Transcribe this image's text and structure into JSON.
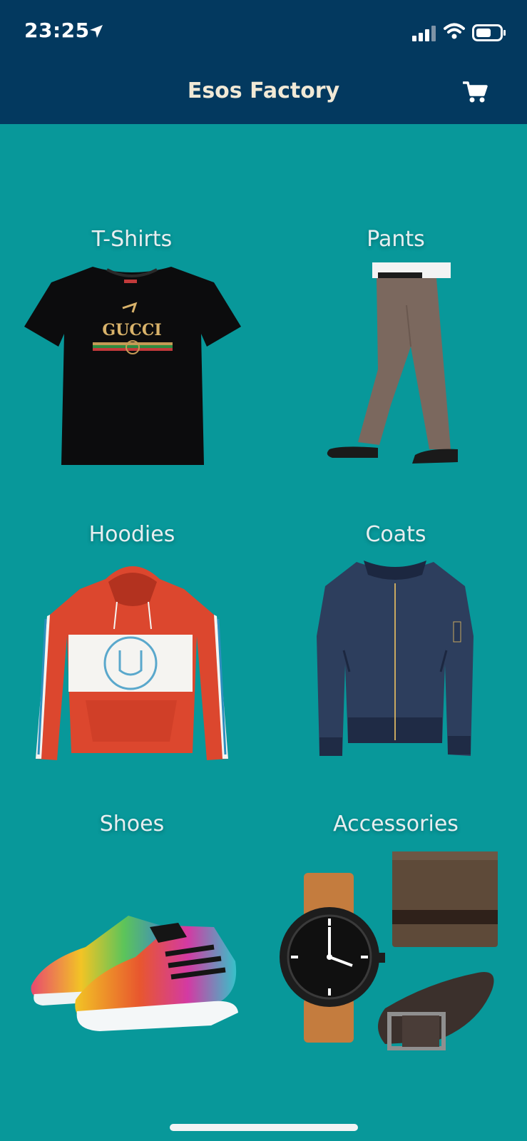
{
  "status_bar": {
    "time": "23:25"
  },
  "header": {
    "title": "Esos Factory",
    "cart_icon": "cart-icon"
  },
  "categories": [
    {
      "label": "T-Shirts",
      "image": "t-shirt"
    },
    {
      "label": "Pants",
      "image": "pants"
    },
    {
      "label": "Hoodies",
      "image": "hoodie"
    },
    {
      "label": "Coats",
      "image": "coat"
    },
    {
      "label": "Shoes",
      "image": "sneakers"
    },
    {
      "label": "Accessories",
      "image": "watch-wallet-belt"
    }
  ],
  "tshirt_logo": "GUCCI",
  "colors": {
    "header_bg": "#03395f",
    "page_bg": "#08989a",
    "title": "#f1e9d6"
  }
}
